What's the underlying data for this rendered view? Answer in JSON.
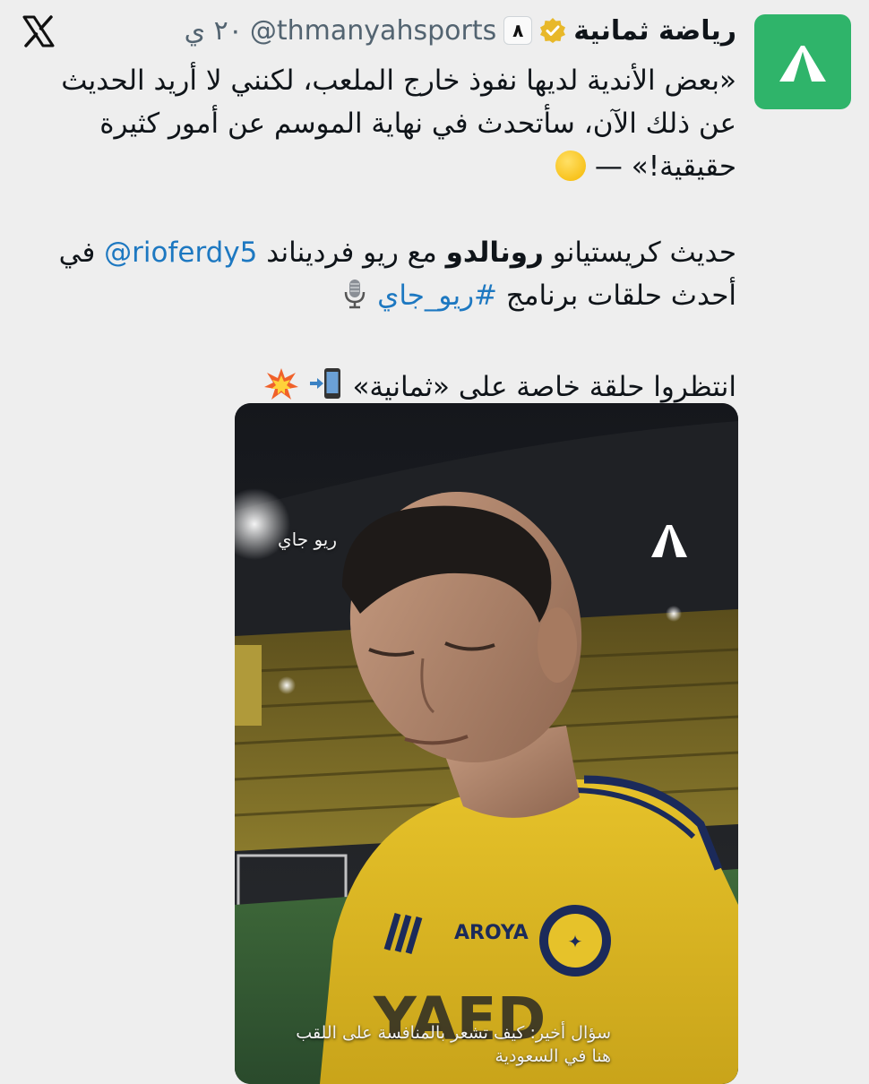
{
  "header": {
    "display_name": "رياضة ثمانية",
    "affiliate_badge_glyph": "٨",
    "handle": "@thmanyahsports",
    "time": "٢٠ ي"
  },
  "icons": {
    "x_logo": "x-logo-icon",
    "verified": "verified-badge-icon",
    "avatar": "thmanyah-logo-icon"
  },
  "tweet": {
    "line1": "«بعض الأندية لديها نفوذ خارج الملعب، لكنني لا أريد الحديث عن ذلك الآن، سأتحدث في نهاية الموسم عن أمور كثيرة حقيقية!» —",
    "line2_prefix": "حديث كريستيانو",
    "line2_bold": "رونالدو",
    "line2_mid": "مع ريو فرديناند",
    "line2_mention": "@rioferdy5",
    "line2_suffix": "في أحدث حلقات برنامج",
    "line2_hashtag": "#ريو_جاي",
    "line3": "انتظروا حلقة خاصة على «ثمانية»"
  },
  "media": {
    "watermark_label": "ريو جاي",
    "caption": "سؤال أخير: كيف تشعر بالمنافسة على اللقب هنا في السعودية",
    "jersey_sponsor": "AROYA",
    "jersey_front": "YAED"
  },
  "colors": {
    "background": "#eeeeee",
    "brand_green": "#2fb46a",
    "link": "#1d78c1",
    "verified_gold": "#e8b829",
    "jersey_yellow": "#e9c21e"
  }
}
